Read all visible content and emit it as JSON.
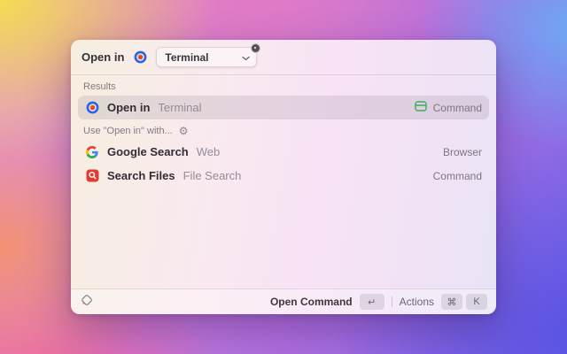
{
  "header": {
    "title": "Open in",
    "dropdown": {
      "value": "Terminal"
    }
  },
  "sections": {
    "results_label": "Results",
    "use_with_label": "Use \"Open in\" with..."
  },
  "rows": [
    {
      "title": "Open in",
      "subtitle": "Terminal",
      "accessory": "Command"
    },
    {
      "title": "Google Search",
      "subtitle": "Web",
      "accessory": "Browser"
    },
    {
      "title": "Search Files",
      "subtitle": "File Search",
      "accessory": "Command"
    }
  ],
  "footer": {
    "primary_label": "Open Command",
    "primary_key": "↵",
    "actions_label": "Actions",
    "actions_key_1": "⌘",
    "actions_key_2": "K"
  },
  "icons": {
    "gear": "⚙"
  },
  "colors": {
    "command_green": "#3cae5c",
    "search_files_red": "#e33b30",
    "open_in_blue": "#2566e8",
    "google_blue": "#4285F4",
    "google_red": "#EA4335",
    "google_yellow": "#FBBC05",
    "google_green": "#34A853"
  }
}
